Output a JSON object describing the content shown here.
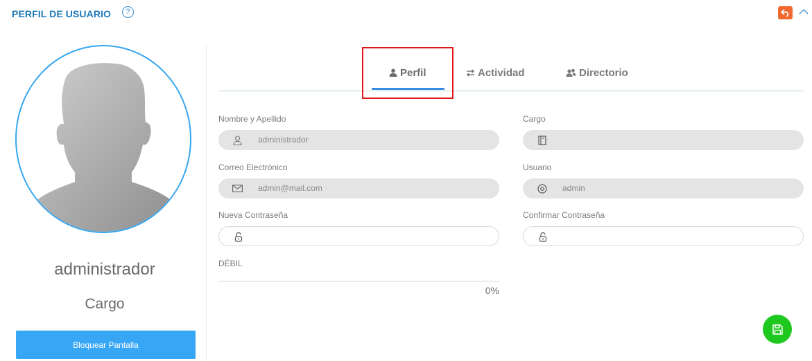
{
  "header": {
    "title": "PERFIL DE USUARIO",
    "help_icon": "question-circle-icon",
    "back_icon": "undo-arrow-icon",
    "collapse_icon": "chevron-up-icon"
  },
  "profile": {
    "name": "administrador",
    "cargo": "Cargo",
    "lock_button": "Bloquear Pantalla",
    "avatar_icon": "default-user-silhouette"
  },
  "tabs": [
    {
      "label": "Perfil",
      "icon": "user-icon",
      "active": true
    },
    {
      "label": "Actividad",
      "icon": "exchange-arrows-icon",
      "active": false
    },
    {
      "label": "Directorio",
      "icon": "users-icon",
      "active": false
    }
  ],
  "form": {
    "nombre": {
      "label": "Nombre y Apellido",
      "value": "administrador",
      "icon": "user-outline-icon"
    },
    "cargo": {
      "label": "Cargo",
      "value": "",
      "icon": "book-icon"
    },
    "correo": {
      "label": "Correo Electrónico",
      "value": "admin@mail.com",
      "icon": "envelope-icon"
    },
    "usuario": {
      "label": "Usuario",
      "value": "admin",
      "icon": "at-sign-icon"
    },
    "nueva": {
      "label": "Nueva Contraseña",
      "value": "",
      "icon": "unlock-icon"
    },
    "confirmar": {
      "label": "Confirmar Contraseña",
      "value": "",
      "icon": "unlock-icon"
    }
  },
  "password_strength": {
    "label": "DÉBIL",
    "percent_text": "0%",
    "value": 0
  },
  "save_icon": "floppy-disk-icon",
  "colors": {
    "title": "#1e7bb8",
    "accent_blue": "#37a6f5",
    "tab_underline": "#3b8de3",
    "back_button": "#f0682e",
    "save_button": "#1ec81e",
    "highlight": "#e0191d"
  }
}
